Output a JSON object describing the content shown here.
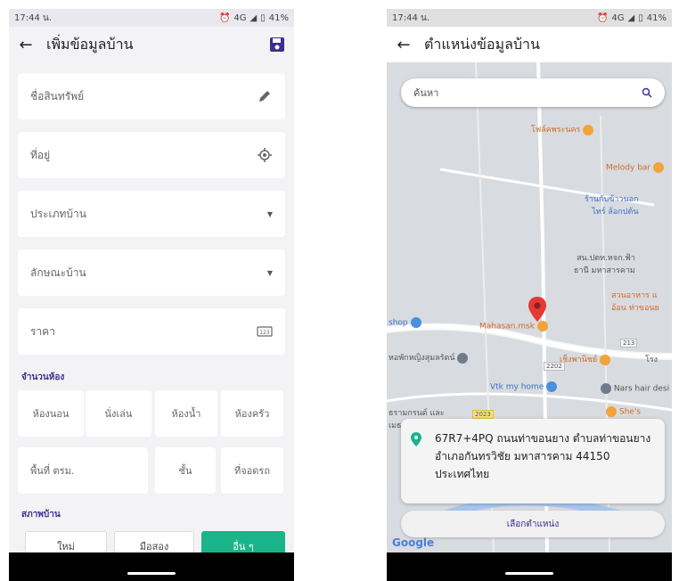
{
  "status_bar": {
    "time": "17:44 น.",
    "network": "4G",
    "battery": "41%"
  },
  "left_screen": {
    "title": "เพิ่มข้อมูลบ้าน",
    "fields": {
      "asset_name": "ชื่อสินทรัพย์",
      "address": "ที่อยู่",
      "house_type": "ประเภทบ้าน",
      "house_style": "ลักษณะบ้าน",
      "price": "ราคา"
    },
    "rooms_section": "จำนวนห้อง",
    "rooms": [
      "ห้องนอน",
      "นั่งเล่น",
      "ห้องน้ำ",
      "ห้องครัว"
    ],
    "area_row": [
      "พื้นที่ ตรม.",
      "ชั้น",
      "ที่จอดรถ"
    ],
    "condition_section": "สภาพบ้าน",
    "condition_options": [
      "ใหม่",
      "มือสอง",
      "อื่น ๆ"
    ],
    "condition_selected": "อื่น ๆ",
    "accent_color": "#19b48a",
    "heading_color": "#3b2f8f"
  },
  "right_screen": {
    "title": "ตำแหน่งข้อมูลบ้าน",
    "search_placeholder": "ค้นหา",
    "pois": {
      "p1": "โฟล์คพระนคร",
      "p2": "Melody bar",
      "p3": "ร้านกับข้าวนอก",
      "p3b": "ไทร์ ล้อกปต้น",
      "p4": "สน.ปตท.หจก.ฟ้า",
      "p4b": "ธานี มหาสารคาม",
      "p5": "สวนอาหาร แ",
      "p5b": "อ้อน ท่าขอนย",
      "p6": "shop",
      "p7": "Mahasan.msk",
      "p8": "หอพักหญิงสุมลรัตน์",
      "p9": "เช็งพานิชย์",
      "p10": "โรง",
      "p11": "Vtk my home",
      "p12": "Nars hair desi",
      "p13": "ธรามกรนด์ และ",
      "p13b": "เมธาวัณกร",
      "p14": "She's"
    },
    "road_labels": [
      "213",
      "2202",
      "2023"
    ],
    "address": "67R7+4PQ ถนนท่าขอนยาง ตำบลท่าขอนยาง อำเภอกันทรวิชัย มหาสารคาม 44150 ประเทศไทย",
    "select_button": "เลือกตำแหน่ง",
    "map_brand": "Google"
  }
}
